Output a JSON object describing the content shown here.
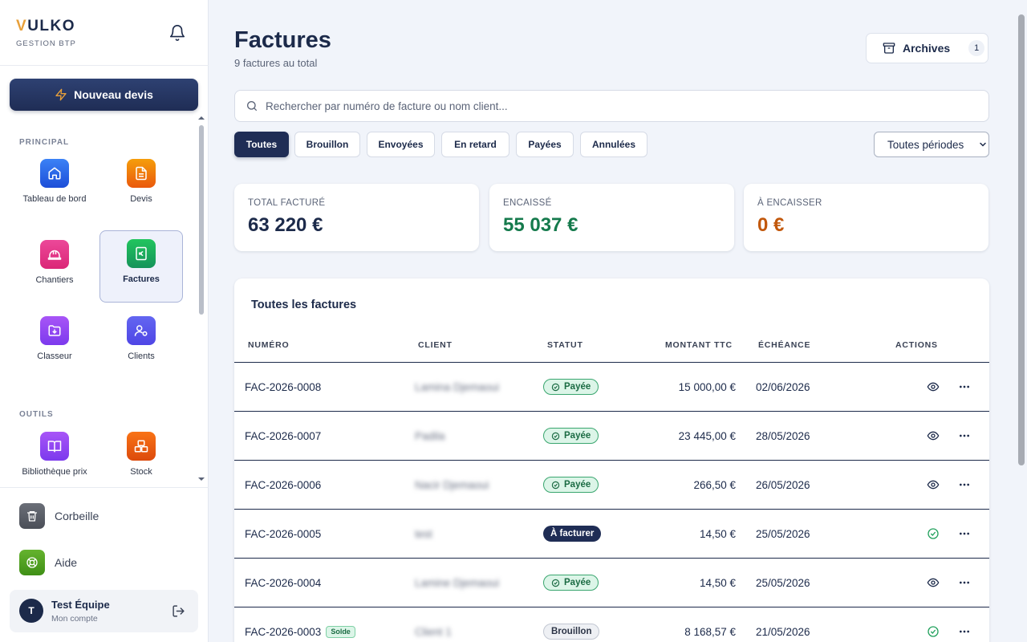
{
  "brand": {
    "letter": "V",
    "rest": "ULKO",
    "subtitle": "GESTION BTP"
  },
  "sidebar": {
    "new_quote": "Nouveau devis",
    "section_main": "PRINCIPAL",
    "section_tools": "OUTILS",
    "items": [
      {
        "label": "Tableau de bord",
        "icon": "home-icon",
        "color": "#2563eb"
      },
      {
        "label": "Devis",
        "icon": "document-icon",
        "color": "#ea7a0c"
      },
      {
        "label": "Chantiers",
        "icon": "hard-hat-icon",
        "color": "#e11d63"
      },
      {
        "label": "Factures",
        "icon": "invoice-euro-icon",
        "color": "#16a05a"
      },
      {
        "label": "Classeur",
        "icon": "folder-icon",
        "color": "#8b3ff0"
      },
      {
        "label": "Clients",
        "icon": "users-settings-icon",
        "color": "#5b4ff0"
      },
      {
        "label": "Bibliothèque prix",
        "icon": "book-icon",
        "color": "#8b3ff0"
      },
      {
        "label": "Stock",
        "icon": "boxes-icon",
        "color": "#ea580c"
      }
    ],
    "trash": "Corbeille",
    "help": "Aide",
    "user": {
      "initial": "T",
      "name": "Test Équipe",
      "sub": "Mon compte"
    }
  },
  "header": {
    "title": "Factures",
    "subtitle": "9 factures au total",
    "archives_label": "Archives",
    "archives_count": "1"
  },
  "search": {
    "placeholder": "Rechercher par numéro de facture ou nom client..."
  },
  "filters": [
    "Toutes",
    "Brouillon",
    "Envoyées",
    "En retard",
    "Payées",
    "Annulées"
  ],
  "period": "Toutes périodes",
  "stats": [
    {
      "label": "TOTAL FACTURÉ",
      "value": "63 220 €",
      "color": "#1c2a4a"
    },
    {
      "label": "ENCAISSÉ",
      "value": "55 037 €",
      "color": "#157a4c"
    },
    {
      "label": "À ENCAISSER",
      "value": "0 €",
      "color": "#c2580c"
    }
  ],
  "table": {
    "title": "Toutes les factures",
    "headers": [
      "NUMÉRO",
      "CLIENT",
      "STATUT",
      "MONTANT TTC",
      "ÉCHÉANCE",
      "ACTIONS"
    ],
    "rows": [
      {
        "number": "FAC-2026-0008",
        "client": "Lamina Djemaoui",
        "status": "Payée",
        "amount": "15 000,00 €",
        "due": "02/06/2026"
      },
      {
        "number": "FAC-2026-0007",
        "client": "Padila",
        "status": "Payée",
        "amount": "23 445,00 €",
        "due": "28/05/2026"
      },
      {
        "number": "FAC-2026-0006",
        "client": "Nacir Djemaoui",
        "status": "Payée",
        "amount": "266,50 €",
        "due": "26/05/2026"
      },
      {
        "number": "FAC-2026-0005",
        "client": "test",
        "status": "À facturer",
        "amount": "14,50 €",
        "due": "25/05/2026"
      },
      {
        "number": "FAC-2026-0004",
        "client": "Lamine Djemaoui",
        "status": "Payée",
        "amount": "14,50 €",
        "due": "25/05/2026"
      },
      {
        "number": "FAC-2026-0003",
        "client": "Client 1",
        "status": "Brouillon",
        "amount": "8 168,57 €",
        "due": "21/05/2026",
        "tag": "Solde"
      }
    ]
  }
}
